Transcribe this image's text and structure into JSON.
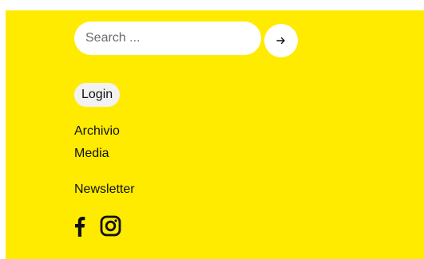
{
  "search": {
    "placeholder": "Search ...",
    "value": "",
    "submit_icon": "arrow-right-icon"
  },
  "auth": {
    "login_label": "Login"
  },
  "nav": {
    "items": [
      {
        "label": "Archivio"
      },
      {
        "label": "Media"
      },
      {
        "label": "Newsletter"
      }
    ]
  },
  "social": {
    "icons": [
      "facebook-icon",
      "instagram-icon"
    ]
  },
  "colors": {
    "background": "#ffeb00",
    "input_bg": "#ffffff",
    "button_bg": "#f2f2f2",
    "text": "#111111"
  }
}
